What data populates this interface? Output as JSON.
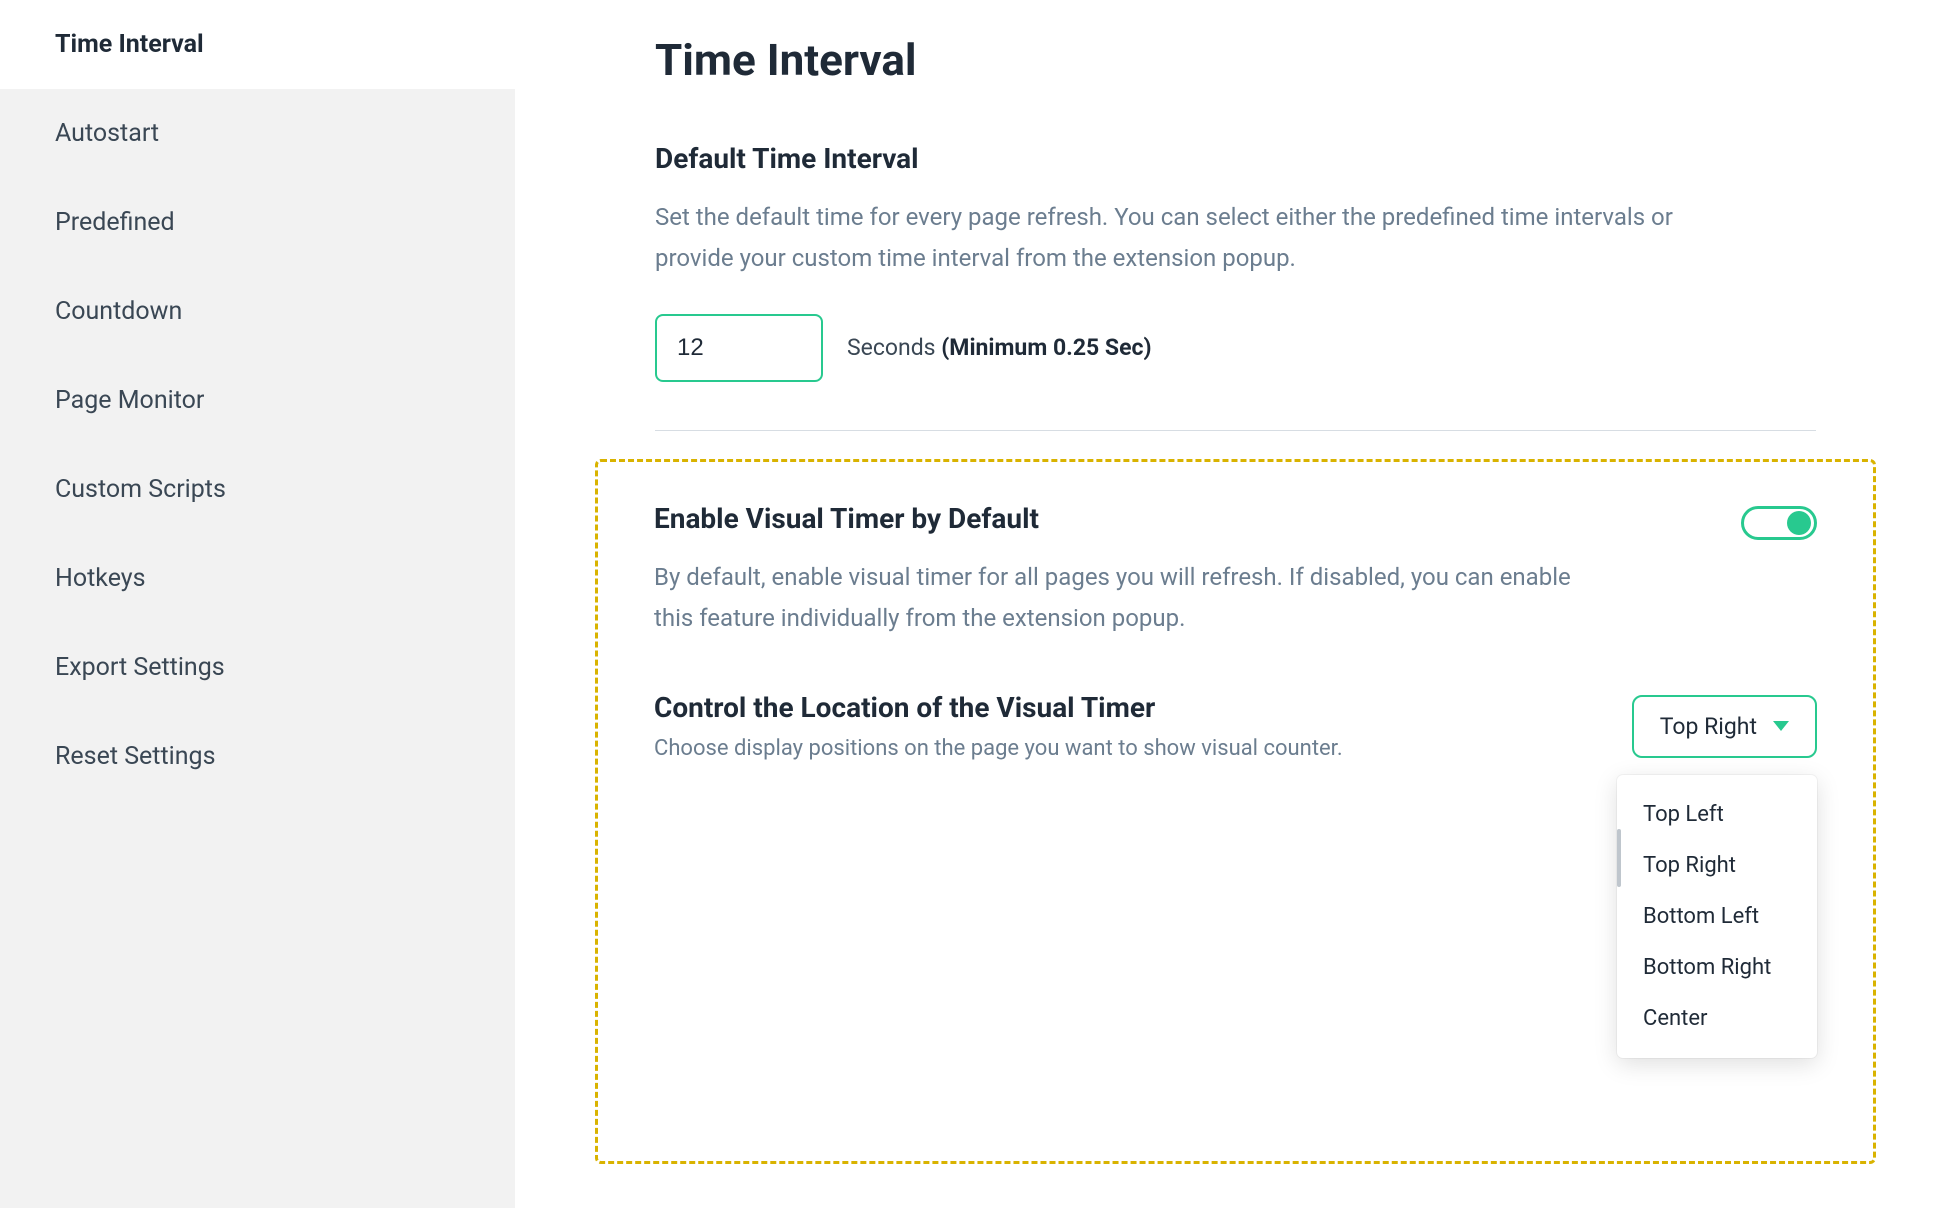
{
  "sidebar": {
    "items": [
      {
        "label": "Time Interval",
        "active": true
      },
      {
        "label": "Autostart"
      },
      {
        "label": "Predefined"
      },
      {
        "label": "Countdown"
      },
      {
        "label": "Page Monitor"
      },
      {
        "label": "Custom Scripts"
      },
      {
        "label": "Hotkeys"
      },
      {
        "label": "Export Settings"
      },
      {
        "label": "Reset Settings"
      }
    ]
  },
  "page": {
    "title": "Time Interval"
  },
  "default_interval": {
    "heading": "Default Time Interval",
    "description": "Set the default time for every page refresh. You can select either the predefined time intervals or provide your custom time interval from the extension popup.",
    "value": "12",
    "unit_prefix": "Seconds ",
    "unit_bold": "(Minimum 0.25 Sec)"
  },
  "visual_timer": {
    "heading": "Enable Visual Timer by Default",
    "description": "By default, enable visual timer for all pages you will refresh. If disabled, you can enable this feature individually from the extension popup.",
    "enabled": true,
    "location_heading": "Control the Location of the Visual Timer",
    "location_description": "Choose display positions on the page you want to show visual counter.",
    "selected": "Top Right",
    "options": [
      "Top Left",
      "Top Right",
      "Bottom Left",
      "Bottom Right",
      "Center"
    ]
  }
}
